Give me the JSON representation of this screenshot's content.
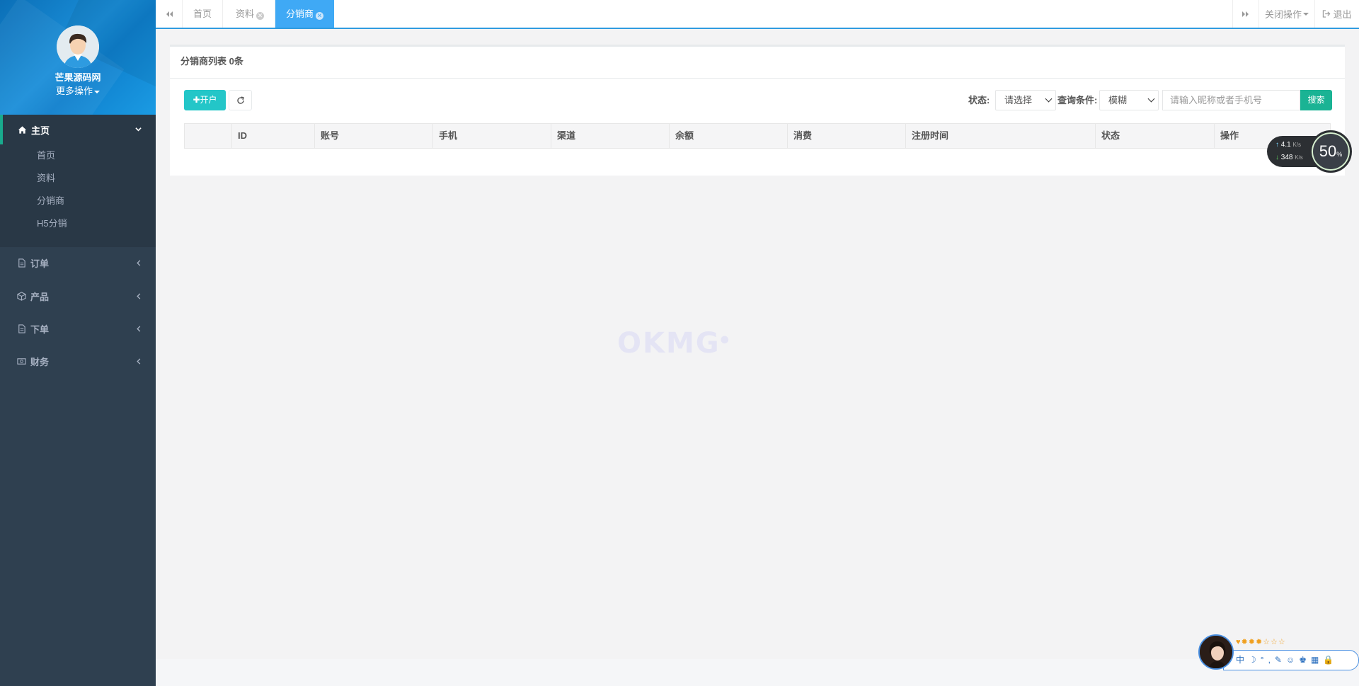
{
  "sidebar": {
    "profile_name": "芒果源码网",
    "profile_more": "更多操作",
    "main_label": "主页",
    "sub_items": [
      {
        "label": "首页"
      },
      {
        "label": "资料"
      },
      {
        "label": "分销商"
      },
      {
        "label": "H5分销"
      }
    ],
    "items": [
      {
        "label": "订单",
        "icon": "file-icon"
      },
      {
        "label": "产品",
        "icon": "cube-icon"
      },
      {
        "label": "下单",
        "icon": "file-icon"
      },
      {
        "label": "财务",
        "icon": "money-icon"
      }
    ]
  },
  "tabs": [
    {
      "label": "首页",
      "closable": false
    },
    {
      "label": "资料",
      "closable": true
    },
    {
      "label": "分销商",
      "closable": true,
      "active": true
    }
  ],
  "topbar": {
    "close_ops": "关闭操作",
    "logout": "退出"
  },
  "panel": {
    "title": "分销商列表 0条",
    "add_button": "开户",
    "status_label": "状态:",
    "status_value": "请选择",
    "query_label": "查询条件:",
    "query_value": "模糊",
    "search_placeholder": "请输入昵称或者手机号",
    "search_button": "搜索"
  },
  "table": {
    "columns": [
      "",
      "ID",
      "账号",
      "手机",
      "渠道",
      "余额",
      "消费",
      "注册时间",
      "状态",
      "操作"
    ]
  },
  "watermark": "OKMG",
  "netwidget": {
    "up": "4.1",
    "up_unit": "K/s",
    "down": "348",
    "down_unit": "K/s",
    "percent": "50",
    "percent_unit": "%"
  },
  "colors": {
    "sidebar": "#2f4050",
    "accent": "#1ab394",
    "tab_active": "#3fa9f5",
    "add_button": "#23c6c8"
  }
}
